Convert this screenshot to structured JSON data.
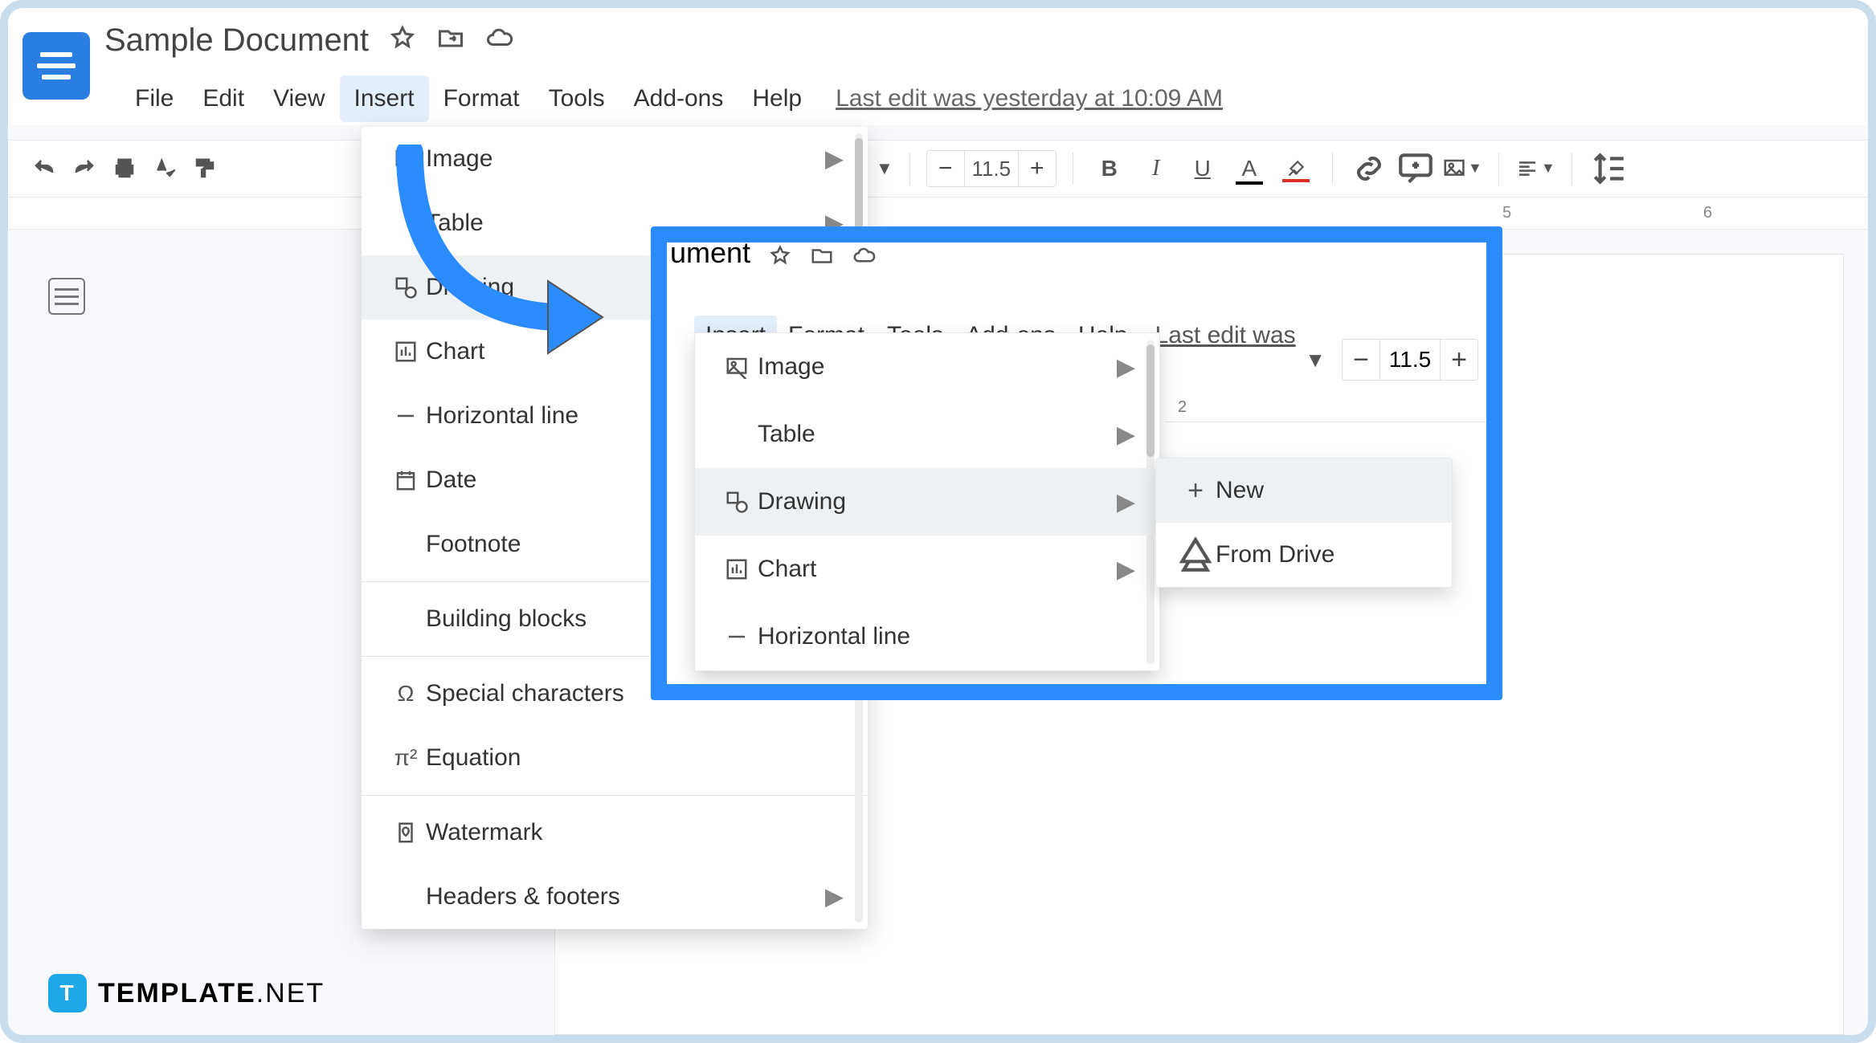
{
  "doc": {
    "title": "Sample Document",
    "last_edit": "Last edit was yesterday at 10:09 AM"
  },
  "menus": {
    "file": "File",
    "edit": "Edit",
    "view": "View",
    "insert": "Insert",
    "format": "Format",
    "tools": "Tools",
    "addons": "Add-ons",
    "help": "Help"
  },
  "insert_menu": {
    "image": "Image",
    "table": "Table",
    "drawing": "Drawing",
    "chart": "Chart",
    "hline": "Horizontal line",
    "date": "Date",
    "footnote": "Footnote",
    "building_blocks": "Building blocks",
    "special_chars": "Special characters",
    "equation": "Equation",
    "watermark_item": "Watermark",
    "headers_footers": "Headers & footers"
  },
  "drawing_submenu": {
    "new": "New",
    "from_drive": "From Drive"
  },
  "toolbar": {
    "font_size": "11.5",
    "zoom_caret": "▼"
  },
  "ruler": {
    "n2": "2",
    "n5": "5",
    "n6": "6"
  },
  "zoom": {
    "title_fragment": "ument",
    "history_fragment": "Last edit was",
    "font_size": "11.5"
  },
  "watermark": {
    "brand_bold": "TEMPLATE",
    "brand_net": ".NET",
    "t": "T"
  }
}
